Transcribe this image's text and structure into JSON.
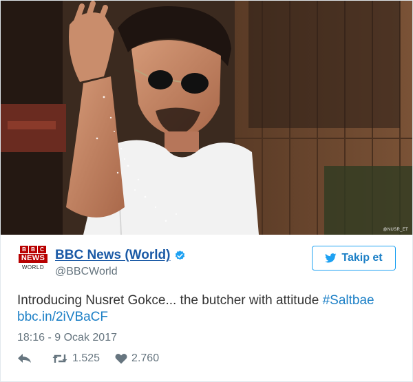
{
  "media": {
    "watermark": "@NUSR_ET"
  },
  "account": {
    "logo_bbc_letters": [
      "B",
      "B",
      "C"
    ],
    "logo_news": "NEWS",
    "logo_world": "WORLD",
    "display_name": "BBC News (World)",
    "handle": "@BBCWorld",
    "verified": true
  },
  "follow_button": {
    "label": "Takip et",
    "icon": "twitter-bird-icon"
  },
  "tweet": {
    "text": "Introducing Nusret Gokce... the butcher with attitude",
    "hashtag": "#Saltbae",
    "link": "bbc.in/2iVBaCF",
    "timestamp": "18:16 - 9 Ocak 2017"
  },
  "actions": {
    "reply_icon": "reply-icon",
    "retweet_icon": "retweet-icon",
    "retweet_count": "1.525",
    "like_icon": "heart-icon",
    "like_count": "2.760"
  },
  "colors": {
    "link_blue": "#1b7fc6",
    "name_blue": "#1b5aa6",
    "bbc_red": "#b80000",
    "muted_gray": "#66757f",
    "twitter_blue": "#1da1f2"
  }
}
